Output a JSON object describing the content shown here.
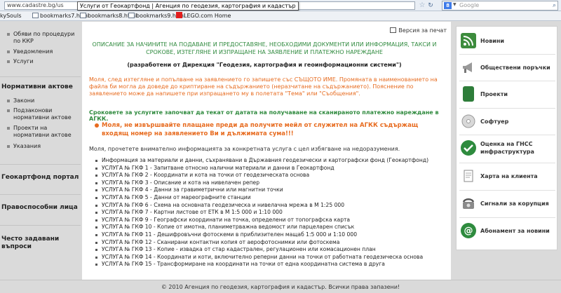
{
  "browser": {
    "url": "www.cadastre.bg/us",
    "tooltip": "Услуги от Геокартфонд | Агенция по геодезия, картография и кадастър",
    "search_placeholder": "Google"
  },
  "bookmarks": [
    "kySouls",
    "bookmarks7.html",
    "bookmarks8.html",
    "bookmarks9.html",
    "LEGO.com Home"
  ],
  "sidebar": {
    "top_links": [
      "Обяви по процедури по ККР",
      "Уведомления",
      "Услуги"
    ],
    "section_normative": "Нормативни актове",
    "normative_links": [
      "Закони",
      "Подзаконови нормативни актове",
      "Проекти на нормативни актове",
      "Указания"
    ],
    "section_geocartfond": "Геокартфонд портал",
    "section_legal": "Правоспособни лица",
    "section_faq": "Често задавани въпроси"
  },
  "main": {
    "print_label": "Версия за печат",
    "title": "ОПИСАНИЕ ЗА НАЧИНИТЕ НА ПОДАВАНЕ И ПРЕДОСТАВЯНЕ, НЕОБХОДИМИ ДОКУМЕНТИ ИЛИ ИНФОРМАЦИЯ, ТАКСИ И СРОКОВЕ, ИЗТЕГЛЯНЕ И ИЗПРАЩАНЕ НА ЗАЯВЛЕНИЕ И ПЛАТЕЖНО НАРЕЖДАНЕ",
    "developed_by": "(разработени от Дирекция \"Геодезия, картография и геоинформационни системи\")",
    "note_1": "Моля, след изтегляне и попълване на заявлението го запишете със СЪЩОТО ИМЕ. Промяната в наименованието на файла би могла да доведе до криптиране на съдържанието (неразчитане на съдържанието). Пояснение по заявлението може да напишете при изпращането му в полетата \"Тема\" или \"Съобщения\".",
    "note_2": "Сроковете за услугите започват да текат от датата на получаване на сканираното платежно нареждане в АГКК.",
    "warning": "Моля, не извършвайте плащане преди да получите мейл от служител на АГКК съдържащ входящ номер на заявлението Ви и дължимата сума!!!",
    "intro": "Моля, прочетете внимателно информацията за конкретната услуга с цел избягване на недоразумения.",
    "items": [
      "Информация за материали и данни, съхранявани в Държавния геодезически и картографски фонд (Геокартфонд)",
      "УСЛУГА № ГКФ 1 - Запитване относно налични материали и данни в Геокартфонд",
      "УСЛУГА № ГКФ 2 - Координати и кота на точки от геодезическата основа",
      "УСЛУГА № ГКФ 3 - Описание и кота на нивелачен репер",
      "УСЛУГА № ГКФ 4 - Данни за гравиметрични или магнитни точки",
      "УСЛУГА № ГКФ 5 - Данни от мареографните станции",
      "УСЛУГА № ГКФ 6 - Схема на основната геодезическа и нивелачна мрежа в М 1:25 000",
      "УСЛУГА № ГКФ 7 - Картни листове от ЕТК в М 1:5 000 и 1:10 000",
      "УСЛУГА № ГКФ 9 - Географски координати на точка, определени от топографска карта",
      "УСЛУГА № ГКФ 10 - Копие от имотна, планиметрважна ведомост или парцеларен списък",
      "УСЛУГА № ГКФ 11 - Дешифровъчни фотоскеми в приблизителен мащаб 1:5 000 и 1:10 000",
      "УСЛУГА № ГКФ 12 - Сканирани контактни копия от аерофотоснимки или фотоскема",
      "УСЛУГА № ГКФ 13 - Копие - извадка от стар кадастрален, регулационен или комасационен план",
      "УСЛУГА № ГКФ 14 - Координати и коти, включително реперни данни на точки от работната геодезическа основа",
      "УСЛУГА № ГКФ 15 - Трансформиране на координати на точки от една координатна система в друга"
    ]
  },
  "right_panel": [
    {
      "label": "Новини",
      "icon": "rss-icon"
    },
    {
      "label": "Обществени поръчки",
      "icon": "megaphone-icon"
    },
    {
      "label": "Проекти",
      "icon": "book-icon"
    },
    {
      "label": "Софтуер",
      "icon": "cd-icon"
    },
    {
      "label": "Оценка на ГНСС инфраструктура",
      "icon": "checkmark-icon"
    },
    {
      "label": "Харта на клиента",
      "icon": "document-icon"
    },
    {
      "label": "Сигнали за корупция",
      "icon": "phone-icon"
    },
    {
      "label": "Абонамент за новини",
      "icon": "at-icon"
    }
  ],
  "footer": "© 2010 Агенция по геодезия, картография и кадастър. Всички права запазени!",
  "colors": {
    "accent_green": "#2f8a3e",
    "accent_orange": "#e76b1f"
  }
}
